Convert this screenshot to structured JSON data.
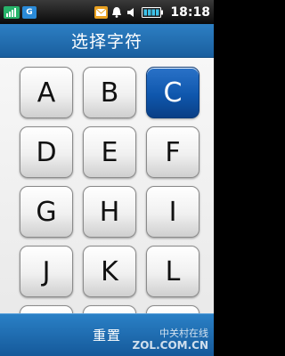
{
  "status_bar": {
    "time": "18:18",
    "left_icons": [
      "signal-icon",
      "app-icon"
    ],
    "right_icons": [
      "message-icon",
      "bell-icon",
      "volume-icon",
      "battery-icon"
    ]
  },
  "title": "选择字符",
  "keys": [
    "A",
    "B",
    "C",
    "D",
    "E",
    "F",
    "G",
    "H",
    "I",
    "J",
    "K",
    "L"
  ],
  "selected_key": "C",
  "bottom_bar": {
    "reset_label": "重置"
  },
  "watermark": {
    "text_cn": "中关村在线",
    "text_en": "ZOL.COM.CN"
  },
  "colors": {
    "accent_blue": "#1a5f9f",
    "selected_key": "#0f57ad"
  }
}
